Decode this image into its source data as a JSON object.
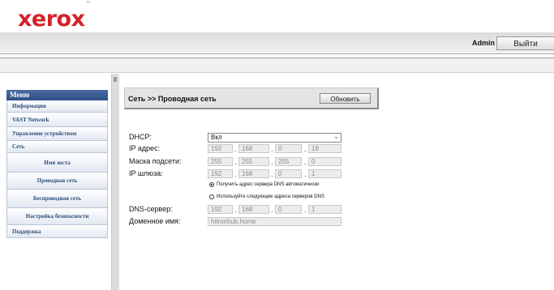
{
  "header": {
    "logo": "xerox",
    "logo_tm": "™",
    "user": "Admin",
    "logout_label": "Выйти"
  },
  "sidebar": {
    "title": "Меню",
    "items": [
      {
        "label": "Информация"
      },
      {
        "label": "VAST Network"
      },
      {
        "label": "Управление устройством"
      },
      {
        "label": "Сеть"
      },
      {
        "label": "Имя хоста"
      },
      {
        "label": "Проводная сеть"
      },
      {
        "label": "Беспроводная сеть"
      },
      {
        "label": "Настройка безопасности"
      },
      {
        "label": "Поддержка"
      }
    ]
  },
  "panel": {
    "breadcrumb": "Сеть >> Проводная сеть",
    "refresh_label": "Обновить"
  },
  "form": {
    "dhcp": {
      "label": "DHCP:",
      "value": "Вкл"
    },
    "ip": {
      "label": "IP адрес:",
      "octets": [
        "192",
        "168",
        "0",
        "18"
      ]
    },
    "mask": {
      "label": "Маска подсети:",
      "octets": [
        "255",
        "255",
        "255",
        "0"
      ]
    },
    "gateway": {
      "label": "IP шлюза:",
      "octets": [
        "192",
        "168",
        "0",
        "1"
      ]
    },
    "dns_auto_label": "Получить адрес сервера DNS автоматически",
    "dns_manual_label": "Используйте следующие адреса серверов DNS",
    "dns_auto_selected": true,
    "dns": {
      "label": "DNS-сервер:",
      "octets": [
        "192",
        "168",
        "0",
        "1"
      ]
    },
    "domain": {
      "label": "Доменное имя:",
      "value": "hitronhub.home"
    }
  },
  "colors": {
    "brand": "#d2232a",
    "menu_header": "#2e4e86",
    "menu_text": "#2e4e7a"
  }
}
